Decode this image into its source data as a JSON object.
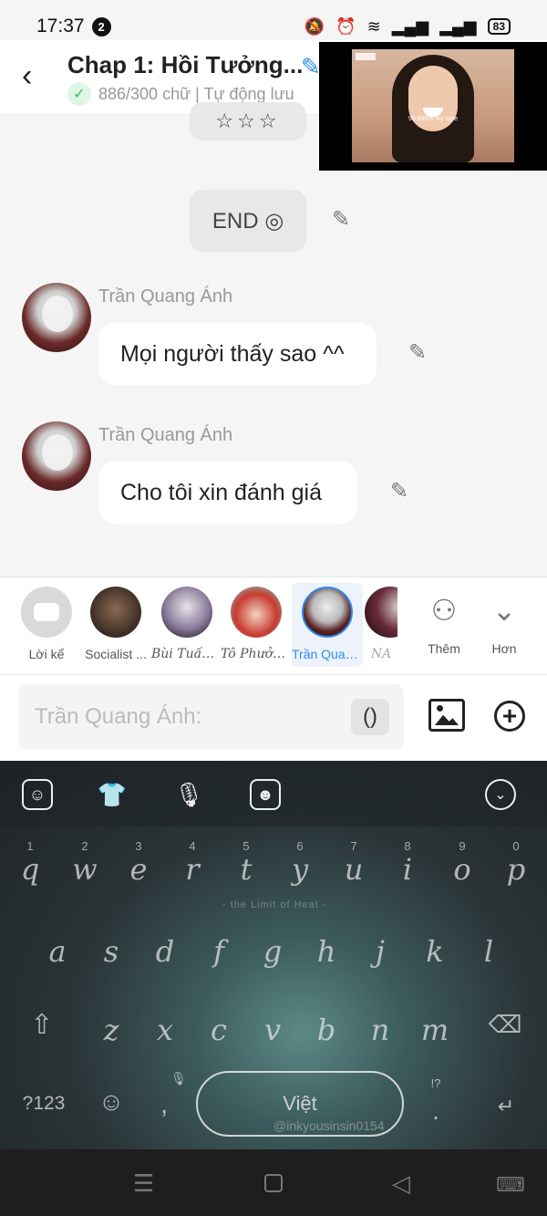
{
  "status_bar": {
    "time": "17:37",
    "notification_count": "2",
    "battery": "83",
    "icons": [
      "mute-icon",
      "alarm-icon",
      "wifi-icon",
      "signal-icon",
      "signal-icon"
    ]
  },
  "header": {
    "title": "Chap 1: Hồi Tưởng...",
    "subtitle": "886/300 chữ | Tự động lưu"
  },
  "video_overlay": {
    "caption": "99.999% my type"
  },
  "chat": {
    "stars": "☆☆☆",
    "end_label": "END ◎",
    "messages": [
      {
        "author": "Trần Quang Ánh",
        "text": "Mọi người thấy sao ^^"
      },
      {
        "author": "Trần Quang Ánh",
        "text": "Cho tôi xin đánh giá"
      }
    ]
  },
  "characters": [
    {
      "label": "Lời kể"
    },
    {
      "label": "Socialist ..."
    },
    {
      "label": "Bùi Tuấn ..."
    },
    {
      "label": "Tô Phưởng..."
    },
    {
      "label": "Trần Quan...",
      "selected": true
    },
    {
      "label": "NA"
    }
  ],
  "char_actions": {
    "more_label": "Thêm",
    "expand_label": "Hơn"
  },
  "input": {
    "placeholder": "Trần Quang Ánh:",
    "paren_label": "()"
  },
  "keyboard": {
    "row1": [
      {
        "num": "1",
        "ch": "q"
      },
      {
        "num": "2",
        "ch": "w"
      },
      {
        "num": "3",
        "ch": "e"
      },
      {
        "num": "4",
        "ch": "r"
      },
      {
        "num": "5",
        "ch": "t"
      },
      {
        "num": "6",
        "ch": "y"
      },
      {
        "num": "7",
        "ch": "u"
      },
      {
        "num": "8",
        "ch": "i"
      },
      {
        "num": "9",
        "ch": "o"
      },
      {
        "num": "0",
        "ch": "p"
      }
    ],
    "row2": [
      "a",
      "s",
      "d",
      "f",
      "g",
      "h",
      "j",
      "k",
      "l"
    ],
    "row3": [
      "z",
      "x",
      "c",
      "v",
      "b",
      "n",
      "m"
    ],
    "symbols_label": "?123",
    "comma": ",",
    "period": ".",
    "period_hint": "!?",
    "space_label": "Việt",
    "banner": "- the Limit of Heat -",
    "watermark": "@inkyousinsin0154"
  },
  "colors": {
    "accent": "#2d8cf0",
    "success": "#2dbb63"
  }
}
